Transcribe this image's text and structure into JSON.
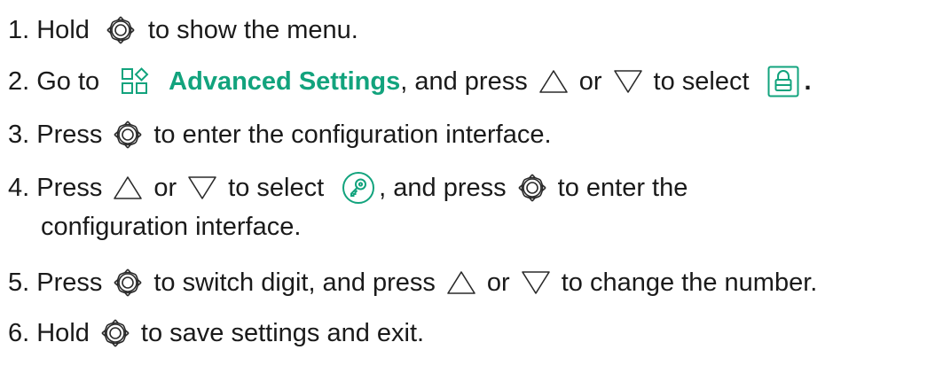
{
  "icons": {
    "ok": "ok-dial-icon",
    "up": "up-triangle-icon",
    "down": "down-triangle-icon",
    "adv": "advanced-settings-grid-icon",
    "lock": "lock-icon",
    "key": "key-icon"
  },
  "colors": {
    "accent": "#12a37d",
    "text": "#1a1a1a"
  },
  "steps": [
    {
      "a": "1. Hold",
      "b": "to show the menu."
    },
    {
      "a": "2. Go to",
      "b": "Advanced Settings",
      "c": ", and press",
      "d": "or",
      "e": "to select",
      "f": "."
    },
    {
      "a": "3. Press",
      "b": "to enter the configuration interface."
    },
    {
      "a": "4. Press",
      "b": "or",
      "c": "to select",
      "d": ", and press",
      "e": "to enter the",
      "f": "configuration interface."
    },
    {
      "a": "5. Press",
      "b": "to switch digit, and press",
      "c": "or",
      "d": "to change the number."
    },
    {
      "a": "6. Hold",
      "b": "to save settings and exit."
    }
  ]
}
